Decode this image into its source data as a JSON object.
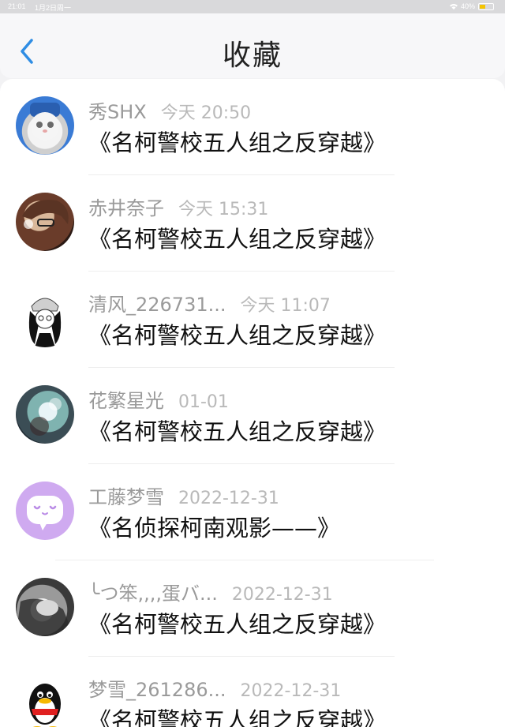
{
  "statusbar": {
    "time": "21:01",
    "date": "1月2日周一",
    "battery": "40%"
  },
  "header": {
    "title": "收藏"
  },
  "items": [
    {
      "name": "秀SHX",
      "time": "今天 20:50",
      "snippet": "《名柯警校五人组之反穿越》"
    },
    {
      "name": "赤井奈子",
      "time": "今天 15:31",
      "snippet": "《名柯警校五人组之反穿越》"
    },
    {
      "name": "清风_226731...",
      "time": "今天 11:07",
      "snippet": "《名柯警校五人组之反穿越》"
    },
    {
      "name": "花繁星光",
      "time": "01-01",
      "snippet": "《名柯警校五人组之反穿越》"
    },
    {
      "name": "工藤梦雪",
      "time": "2022-12-31",
      "snippet": "《名侦探柯南观影——》"
    },
    {
      "name": "╰つ笨,,,,蛋バ...",
      "time": "2022-12-31",
      "snippet": "《名柯警校五人组之反穿越》"
    },
    {
      "name": "梦雪_261286...",
      "time": "2022-12-31",
      "snippet": "《名柯警校五人组之反穿越》"
    }
  ],
  "colors": {
    "accent": "#2f8de4",
    "bubble": "#cfaaf0"
  }
}
